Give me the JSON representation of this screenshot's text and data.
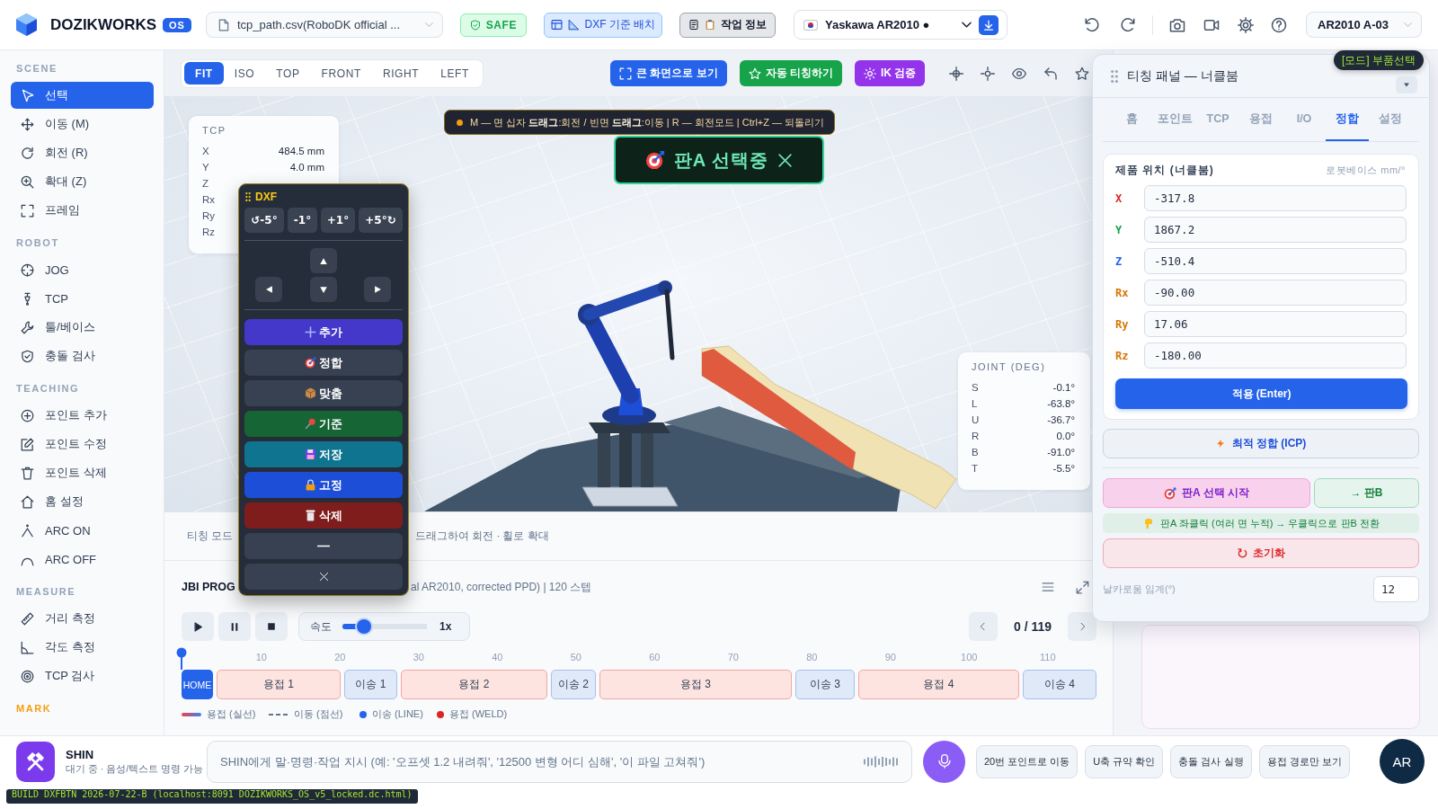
{
  "header": {
    "brand": "DOZIKWORKS",
    "badge": "OS",
    "file": "tcp_path.csv(RoboDK official ...",
    "safety": "SAFE",
    "dxf_button": "DXF 기준 배치",
    "info_button": "작업 정보",
    "robot": "Yaskawa AR2010 ●",
    "station": "AR2010 A-03"
  },
  "sidebar": {
    "sections": [
      {
        "title": "SCENE",
        "color": "#94a3b8",
        "items": [
          {
            "label": "선택",
            "selected": true
          },
          {
            "label": "이동 (M)",
            "selected": false
          },
          {
            "label": "회전 (R)",
            "selected": false
          },
          {
            "label": "확대 (Z)",
            "selected": false
          },
          {
            "label": "프레임",
            "selected": false
          }
        ]
      },
      {
        "title": "ROBOT",
        "color": "#94a3b8",
        "items": [
          {
            "label": "JOG",
            "selected": false
          },
          {
            "label": "TCP",
            "selected": false
          },
          {
            "label": "툴/베이스",
            "selected": false
          },
          {
            "label": "충돌 검사",
            "selected": false
          }
        ]
      },
      {
        "title": "TEACHING",
        "color": "#94a3b8",
        "items": [
          {
            "label": "포인트 추가",
            "selected": false
          },
          {
            "label": "포인트 수정",
            "selected": false
          },
          {
            "label": "포인트 삭제",
            "selected": false
          },
          {
            "label": "홈 설정",
            "selected": false
          },
          {
            "label": "ARC ON",
            "selected": false
          },
          {
            "label": "ARC OFF",
            "selected": false
          }
        ]
      },
      {
        "title": "MEASURE",
        "color": "#94a3b8",
        "items": [
          {
            "label": "거리 측정",
            "selected": false
          },
          {
            "label": "각도 측정",
            "selected": false
          },
          {
            "label": "TCP 검사",
            "selected": false
          }
        ]
      },
      {
        "title": "MARK",
        "color": "#f59e0b"
      }
    ]
  },
  "viewport": {
    "views": [
      {
        "label": "FIT",
        "selected": true
      },
      {
        "label": "ISO",
        "selected": false
      },
      {
        "label": "TOP",
        "selected": false
      },
      {
        "label": "FRONT",
        "selected": false
      },
      {
        "label": "RIGHT",
        "selected": false
      },
      {
        "label": "LEFT",
        "selected": false
      }
    ],
    "actions": [
      {
        "label": "큰 화면으로 보기",
        "color": "#2563eb"
      },
      {
        "label": "자동 티칭하기",
        "color": "#16a34a"
      },
      {
        "label": "IK 검증",
        "color": "#9333ea"
      }
    ],
    "hint": "M — 면 십자 **드래그**:회전 / 빈면 **드래그**:이동 | R — 회전모드 | Ctrl+Z — 되돌리기",
    "selection": "판A 선택중",
    "tcp": {
      "title": "TCP",
      "rows": [
        {
          "label": "X",
          "value": "484.5 mm"
        },
        {
          "label": "Y",
          "value": "4.0 mm"
        },
        {
          "label": "Z"
        },
        {
          "label": "Rx"
        },
        {
          "label": "Ry"
        },
        {
          "label": "Rz"
        }
      ]
    },
    "joint": {
      "title": "JOINT (DEG)",
      "rows": [
        {
          "label": "S",
          "value": "-0.1°"
        },
        {
          "label": "L",
          "value": "-63.8°"
        },
        {
          "label": "U",
          "value": "-36.7°"
        },
        {
          "label": "R",
          "value": "0.0°"
        },
        {
          "label": "B",
          "value": "-91.0°"
        },
        {
          "label": "T",
          "value": "-5.5°"
        }
      ]
    },
    "mode_label": "티칭 모드",
    "mouse_hint": "드래그하여 회전 · 휠로 확대"
  },
  "dxf_panel": {
    "title": "DXF",
    "rotate": [
      "↺-5°",
      "-1°",
      "+1°",
      "+5°↻"
    ],
    "actions": [
      {
        "kind": "add",
        "label": "추가",
        "color": "#4338ca"
      },
      {
        "kind": "match",
        "label": "정합",
        "color": "#374151"
      },
      {
        "kind": "fit",
        "label": "맞춤",
        "color": "#374151"
      },
      {
        "kind": "base",
        "label": "기준",
        "color": "#166534"
      },
      {
        "kind": "save",
        "label": "저장",
        "color": "#0e7490"
      },
      {
        "kind": "lock",
        "label": "고정",
        "color": "#1d4ed8"
      },
      {
        "kind": "delete",
        "label": "삭제",
        "color": "#7f1d1d"
      },
      {
        "kind": "minimize",
        "color": "#374151"
      },
      {
        "kind": "close",
        "color": "#374151"
      }
    ]
  },
  "program": {
    "title": "JBI PROG",
    "subtitle": "al AR2010, corrected PPD) | 120 스텝",
    "speed_label": "속도",
    "speed": {
      "level": 0.25
    },
    "speed_value": "1x",
    "counter": "0 / 119",
    "playhead": {
      "level": 0
    },
    "ticks": [
      "10",
      "20",
      "30",
      "40",
      "50",
      "60",
      "70",
      "80",
      "90",
      "100",
      "110"
    ],
    "segments": [
      {
        "kind": "home",
        "label": "HOME"
      },
      {
        "kind": "weld",
        "label": "용접 1"
      },
      {
        "kind": "move",
        "label": "이송 1"
      },
      {
        "kind": "weld",
        "label": "용접 2"
      },
      {
        "kind": "move",
        "label": "이송 2"
      },
      {
        "kind": "weld",
        "label": "용접 3"
      },
      {
        "kind": "move",
        "label": "이송 3"
      },
      {
        "kind": "weld",
        "label": "용접 4"
      },
      {
        "kind": "move",
        "label": "이송 4"
      }
    ],
    "legend": [
      {
        "kind": "line",
        "label": "용접 (실선)"
      },
      {
        "kind": "dashed",
        "label": "이동 (점선)"
      },
      {
        "kind": "dot",
        "label": "이송 (LINE)",
        "color": "#2563eb"
      },
      {
        "kind": "dot",
        "label": "용접 (WELD)",
        "color": "#dc2626"
      }
    ]
  },
  "teaching_panel": {
    "mode": "[모드] 부품선택",
    "title": "티칭 패널 — 너클붐",
    "tabs": [
      {
        "label": "홈",
        "selected": false
      },
      {
        "label": "포인트",
        "selected": false
      },
      {
        "label": "TCP",
        "selected": false
      },
      {
        "label": "용접",
        "selected": false
      },
      {
        "label": "I/O",
        "selected": false
      },
      {
        "label": "정합",
        "selected": true
      },
      {
        "label": "설정",
        "selected": false
      }
    ],
    "card": {
      "title": "제품 위치 (너클붐)",
      "unit": "로봇베이스 mm/°",
      "fields": [
        {
          "label": "X",
          "value": "-317.8",
          "color": "#dc2626"
        },
        {
          "label": "Y",
          "value": "1867.2",
          "color": "#16a34a"
        },
        {
          "label": "Z",
          "value": "-510.4",
          "color": "#2563eb"
        },
        {
          "label": "Rx",
          "value": "-90.00",
          "color": "#d97706"
        },
        {
          "label": "Ry",
          "value": "17.06",
          "color": "#d97706"
        },
        {
          "label": "Rz",
          "value": "-180.00",
          "color": "#d97706"
        }
      ],
      "apply": "적용 (Enter)"
    },
    "icp": "최적 정합 (ICP)",
    "pick_a": "판A 선택 시작",
    "pick_b": "→ 판B",
    "pick_hint": "판A 좌클릭 (여러 면 누적) → 우클릭으로 판B 전환",
    "reset": "초기화",
    "threshold": {
      "label": "날카로움 임계(°)",
      "value": "12"
    }
  },
  "assistant": {
    "name": "SHIN",
    "status": "대기 중 · 음성/텍스트 명령 가능",
    "command": {
      "placeholder": "SHIN에게 말·명령·작업 지시 (예: '오프셋 1.2 내려줘', '12500 변형 어디 심해', '이 파일 고쳐줘')"
    },
    "chips": [
      "20번 포인트로 이동",
      "U축 규약 확인",
      "충돌 검사 실행",
      "용접 경로만 보기"
    ],
    "user": "AR"
  },
  "build": "BUILD DXFBTN 2026-07-22-B (localhost:8091 DOZIKWORKS_OS_v5_locked.dc.html)"
}
